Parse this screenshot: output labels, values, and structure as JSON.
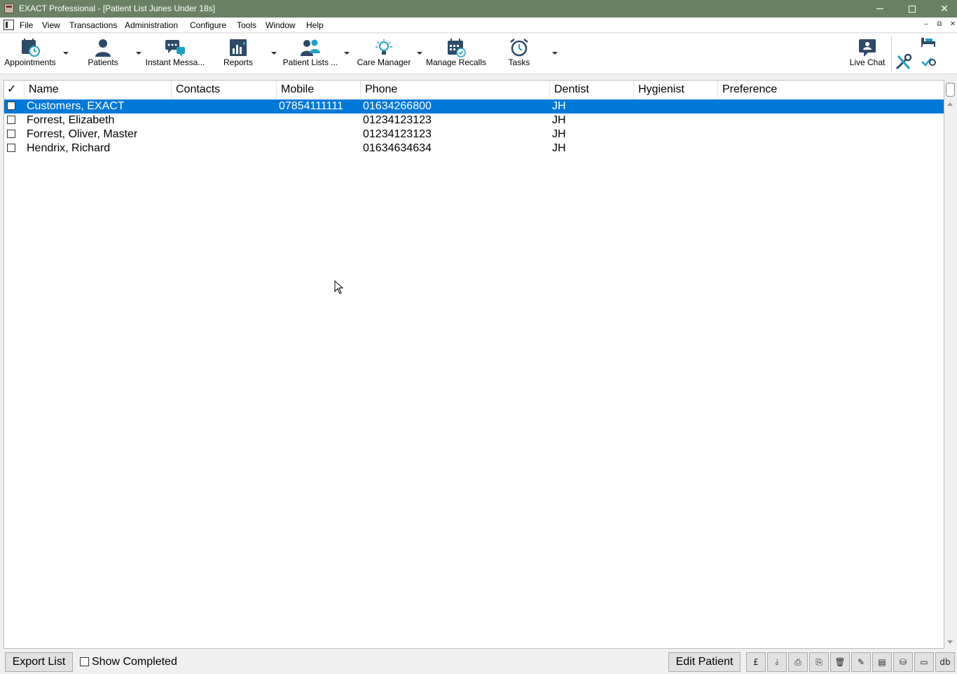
{
  "window": {
    "title": "EXACT Professional - [Patient List Junes Under 18s]",
    "minimize_glyph": "—",
    "maximize_glyph": "☐",
    "close_glyph": "✕"
  },
  "menu": {
    "items": [
      "File",
      "View",
      "Transactions",
      "Administration",
      "Configure",
      "Tools",
      "Window",
      "Help"
    ],
    "mdi_minimize": "–",
    "mdi_restore": "⧉",
    "mdi_close": "✕"
  },
  "toolbar": {
    "items": [
      {
        "label": "Appointments",
        "icon": "calendar-clock-icon"
      },
      {
        "label": "Patients",
        "icon": "person-icon"
      },
      {
        "label": "Instant Messa...",
        "icon": "chat-icon"
      },
      {
        "label": "Reports",
        "icon": "chart-icon"
      },
      {
        "label": "Patient Lists ...",
        "icon": "group-icon"
      },
      {
        "label": "Care Manager",
        "icon": "lightbulb-icon"
      },
      {
        "label": "Manage Recalls",
        "icon": "calendar-check-icon"
      },
      {
        "label": "Tasks",
        "icon": "alarm-clock-icon"
      }
    ],
    "live_chat_label": "Live Chat"
  },
  "list": {
    "check_header": "✓",
    "columns": [
      "Name",
      "Contacts",
      "Mobile",
      "Phone",
      "Dentist",
      "Hygienist",
      "Preference"
    ],
    "rows": [
      {
        "name": "Customers, EXACT",
        "contacts": "",
        "mobile": "07854111111",
        "phone": "01634266800",
        "dentist": "JH",
        "hygienist": "",
        "preference": "",
        "selected": true
      },
      {
        "name": "Forrest, Elizabeth",
        "contacts": "",
        "mobile": "",
        "phone": "01234123123",
        "dentist": "JH",
        "hygienist": "",
        "preference": "",
        "selected": false
      },
      {
        "name": "Forrest, Oliver, Master",
        "contacts": "",
        "mobile": "",
        "phone": "01234123123",
        "dentist": "JH",
        "hygienist": "",
        "preference": "",
        "selected": false
      },
      {
        "name": "Hendrix, Richard",
        "contacts": "",
        "mobile": "",
        "phone": "01634634634",
        "dentist": "JH",
        "hygienist": "",
        "preference": "",
        "selected": false
      }
    ]
  },
  "bottom": {
    "export_label": "Export List",
    "show_completed_label": "Show Completed",
    "show_completed_checked": false,
    "edit_patient_label": "Edit Patient",
    "icon_buttons": [
      {
        "icon": "pound-icon",
        "glyph": "£"
      },
      {
        "icon": "split-icon",
        "glyph": "⫰"
      },
      {
        "icon": "print-letter-icon",
        "glyph": "⎙"
      },
      {
        "icon": "print-label-icon",
        "glyph": "⎘"
      },
      {
        "icon": "delete-icon",
        "glyph": "🗑"
      },
      {
        "icon": "pen-icon",
        "glyph": "✎"
      },
      {
        "icon": "folder-icon",
        "glyph": "▤"
      },
      {
        "icon": "database-icon",
        "glyph": "⛁"
      },
      {
        "icon": "card-icon",
        "glyph": "▭"
      },
      {
        "icon": "db-text-icon",
        "glyph": "db"
      }
    ]
  },
  "colors": {
    "titlebar": "#6a8263",
    "selection": "#0078d7",
    "icon_navy": "#2f4a66",
    "icon_teal": "#1f9fc4"
  }
}
